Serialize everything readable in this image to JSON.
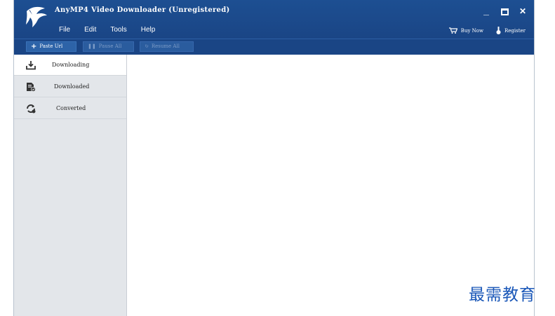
{
  "window": {
    "title": "AnyMP4 Video Downloader (Unregistered)"
  },
  "menu": [
    "File",
    "Edit",
    "Tools",
    "Help"
  ],
  "top_links": {
    "buy": "Buy Now",
    "register": "Register"
  },
  "toolbar": {
    "paste": "Paste Url",
    "pause": "Pause All",
    "resume": "Resume All"
  },
  "sidebar": [
    {
      "label": "Downloading",
      "icon": "download-icon",
      "active": true
    },
    {
      "label": "Downloaded",
      "icon": "downloaded-file-icon",
      "active": false
    },
    {
      "label": "Converted",
      "icon": "convert-icon",
      "active": false
    }
  ],
  "watermark": "最需教育",
  "colors": {
    "titlebar": "#1a4585",
    "sidebar": "#e3e6ea",
    "watermark": "#1a57b8"
  }
}
